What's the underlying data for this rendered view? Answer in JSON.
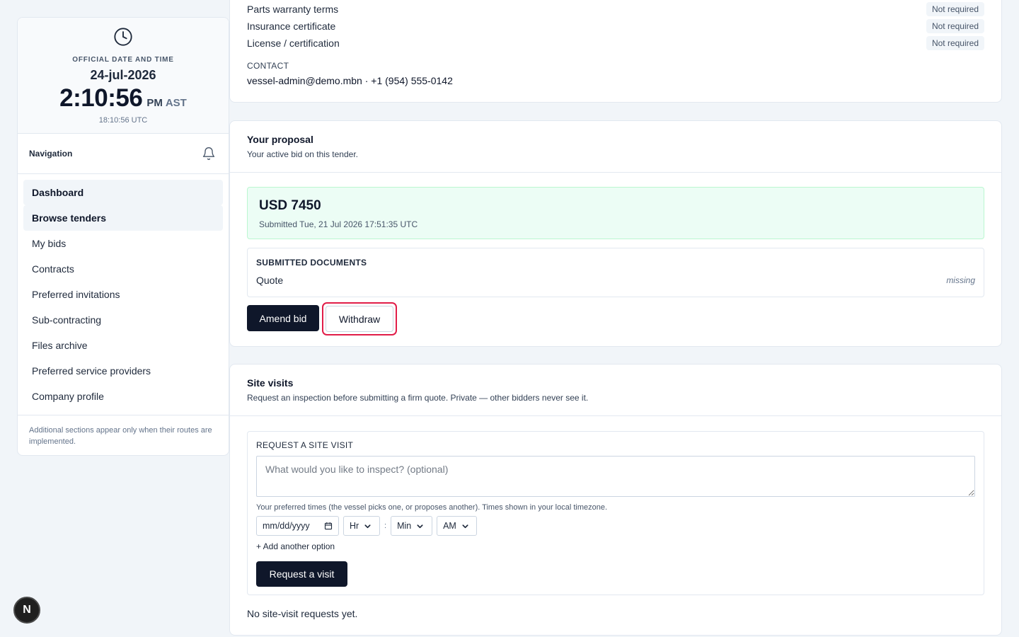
{
  "clock": {
    "label": "OFFICIAL DATE AND TIME",
    "date": "24-jul-2026",
    "time": "2:10:56",
    "ampm": "PM",
    "tz": "AST",
    "utc": "18:10:56 UTC"
  },
  "nav": {
    "title": "Navigation",
    "items": [
      {
        "label": "Dashboard"
      },
      {
        "label": "Browse tenders"
      },
      {
        "label": "My bids"
      },
      {
        "label": "Contracts"
      },
      {
        "label": "Preferred invitations"
      },
      {
        "label": "Sub-contracting"
      },
      {
        "label": "Files archive"
      },
      {
        "label": "Preferred service providers"
      },
      {
        "label": "Company profile"
      }
    ],
    "note": "Additional sections appear only when their routes are implemented."
  },
  "requirements": {
    "rows": [
      {
        "label": "Parts warranty terms",
        "status": "Not required"
      },
      {
        "label": "Insurance certificate",
        "status": "Not required"
      },
      {
        "label": "License / certification",
        "status": "Not required"
      }
    ],
    "contact_label": "CONTACT",
    "contact_value": "vessel-admin@demo.mbn · +1 (954) 555-0142"
  },
  "proposal": {
    "title": "Your proposal",
    "subtitle": "Your active bid on this tender.",
    "price": "USD 7450",
    "submitted": "Submitted Tue, 21 Jul 2026 17:51:35 UTC",
    "docs_title": "SUBMITTED DOCUMENTS",
    "doc_name": "Quote",
    "doc_status": "missing",
    "amend_label": "Amend bid",
    "withdraw_label": "Withdraw"
  },
  "visits": {
    "title": "Site visits",
    "subtitle": "Request an inspection before submitting a firm quote. Private — other bidders never see it.",
    "form_title": "REQUEST A SITE VISIT",
    "textarea_placeholder": "What would you like to inspect? (optional)",
    "hint": "Your preferred times (the vessel picks one, or proposes another). Times shown in your local timezone.",
    "date_placeholder": "mm/dd/yyyy",
    "hour_label": "Hr",
    "minute_label": "Min",
    "ampm_label": "AM",
    "separator": ":",
    "add_option": "+ Add another option",
    "request_label": "Request a visit",
    "empty": "No site-visit requests yet."
  },
  "dev_badge": "N",
  "colors": {
    "accent_dark": "#0f172a",
    "success_bg": "#ecfdf5",
    "focus_ring": "#e11d48"
  }
}
